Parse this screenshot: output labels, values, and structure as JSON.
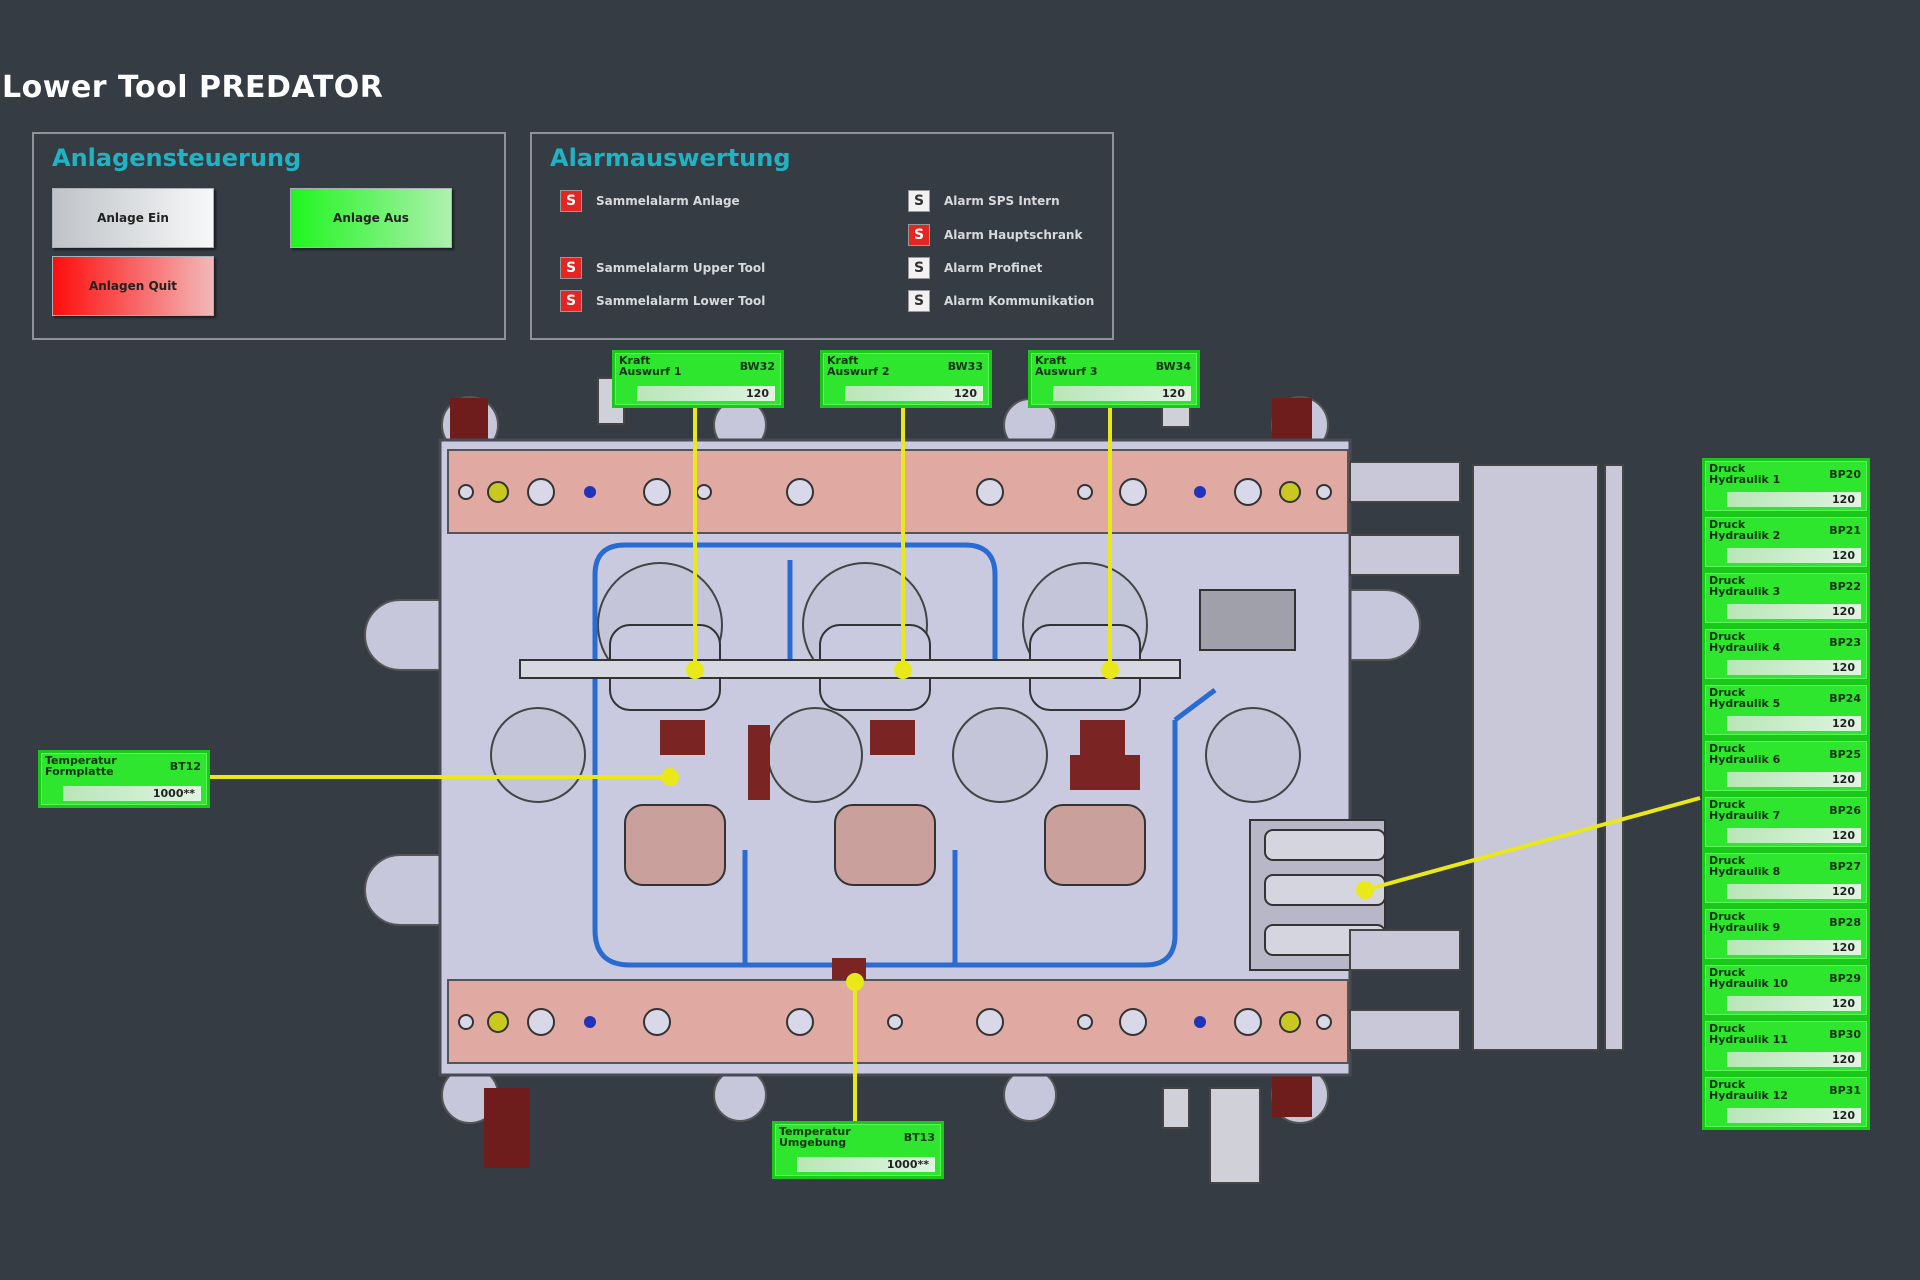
{
  "page": {
    "title": "Lower Tool PREDATOR"
  },
  "control": {
    "title": "Anlagensteuerung",
    "btn_on": "Anlage Ein",
    "btn_off": "Anlage Aus",
    "btn_quit": "Anlagen Quit"
  },
  "alarms": {
    "title": "Alarmauswertung",
    "items": [
      {
        "label": "Sammelalarm Anlage",
        "status": "S",
        "color": "#e52424"
      },
      {
        "label": "Sammelalarm Upper Tool",
        "status": "S",
        "color": "#e52424"
      },
      {
        "label": "Sammelalarm Lower Tool",
        "status": "S",
        "color": "#e52424"
      },
      {
        "label": "Alarm SPS Intern",
        "status": "S",
        "color": "#f2f2f2"
      },
      {
        "label": "Alarm Hauptschrank",
        "status": "S",
        "color": "#e52424"
      },
      {
        "label": "Alarm Profinet",
        "status": "S",
        "color": "#f2f2f2"
      },
      {
        "label": "Alarm Kommunikation",
        "status": "S",
        "color": "#f2f2f2"
      }
    ]
  },
  "force_sensors": [
    {
      "label": "Kraft\nAuswurf 1",
      "code": "BW32",
      "value": "120"
    },
    {
      "label": "Kraft\nAuswurf 2",
      "code": "BW33",
      "value": "120"
    },
    {
      "label": "Kraft\nAuswurf 3",
      "code": "BW34",
      "value": "120"
    }
  ],
  "temp_sensors": [
    {
      "label": "Temperatur\nFormplatte",
      "code": "BT12",
      "value": "1000**"
    },
    {
      "label": "Temperatur\nUmgebung",
      "code": "BT13",
      "value": "1000**"
    }
  ],
  "pressure_sensors": [
    {
      "label": "Druck\nHydraulik 1",
      "code": "BP20",
      "value": "120"
    },
    {
      "label": "Druck\nHydraulik 2",
      "code": "BP21",
      "value": "120"
    },
    {
      "label": "Druck\nHydraulik 3",
      "code": "BP22",
      "value": "120"
    },
    {
      "label": "Druck\nHydraulik 4",
      "code": "BP23",
      "value": "120"
    },
    {
      "label": "Druck\nHydraulik 5",
      "code": "BP24",
      "value": "120"
    },
    {
      "label": "Druck\nHydraulik 6",
      "code": "BP25",
      "value": "120"
    },
    {
      "label": "Druck\nHydraulik 7",
      "code": "BP26",
      "value": "120"
    },
    {
      "label": "Druck\nHydraulik 8",
      "code": "BP27",
      "value": "120"
    },
    {
      "label": "Druck\nHydraulik 9",
      "code": "BP28",
      "value": "120"
    },
    {
      "label": "Druck\nHydraulik 10",
      "code": "BP29",
      "value": "120"
    },
    {
      "label": "Druck\nHydraulik 11",
      "code": "BP30",
      "value": "120"
    },
    {
      "label": "Druck\nHydraulik 12",
      "code": "BP31",
      "value": "120"
    }
  ],
  "colors": {
    "accent": "#1fb3c3",
    "indicator": "#2ee62e",
    "leader": "#e8e81a",
    "plate": "#c9c9df",
    "rail": "#e0a9a1"
  }
}
